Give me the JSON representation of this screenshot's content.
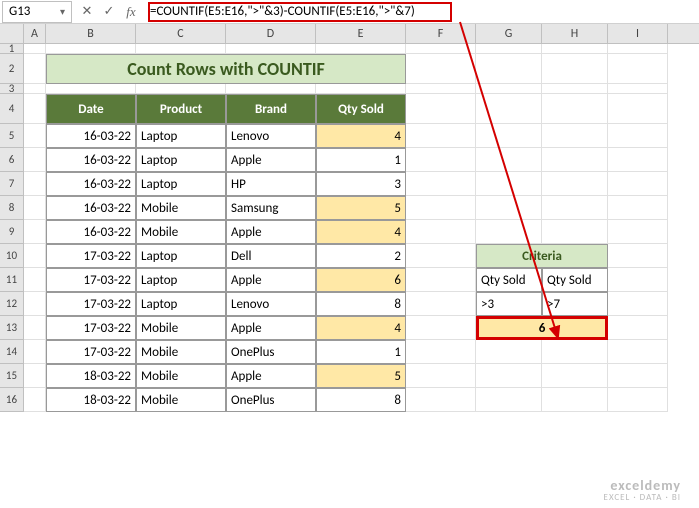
{
  "nameBox": "G13",
  "formula": "=COUNTIF(E5:E16,\">\"&3)-COUNTIF(E5:E16,\">\"&7)",
  "columns": [
    "A",
    "B",
    "C",
    "D",
    "E",
    "F",
    "G",
    "H",
    "I"
  ],
  "rowNums": [
    "1",
    "2",
    "3",
    "4",
    "5",
    "6",
    "7",
    "8",
    "9",
    "10",
    "11",
    "12",
    "13",
    "14",
    "15",
    "16"
  ],
  "title": "Count Rows with COUNTIF",
  "headers": {
    "b": "Date",
    "c": "Product",
    "d": "Brand",
    "e": "Qty Sold"
  },
  "rows": [
    {
      "date": "16-03-22",
      "product": "Laptop",
      "brand": "Lenovo",
      "qty": "4",
      "hl": true
    },
    {
      "date": "16-03-22",
      "product": "Laptop",
      "brand": "Apple",
      "qty": "1",
      "hl": false
    },
    {
      "date": "16-03-22",
      "product": "Laptop",
      "brand": "HP",
      "qty": "3",
      "hl": false
    },
    {
      "date": "16-03-22",
      "product": "Mobile",
      "brand": "Samsung",
      "qty": "5",
      "hl": true
    },
    {
      "date": "16-03-22",
      "product": "Mobile",
      "brand": "Apple",
      "qty": "4",
      "hl": true
    },
    {
      "date": "17-03-22",
      "product": "Laptop",
      "brand": "Dell",
      "qty": "2",
      "hl": false
    },
    {
      "date": "17-03-22",
      "product": "Laptop",
      "brand": "Apple",
      "qty": "6",
      "hl": true
    },
    {
      "date": "17-03-22",
      "product": "Laptop",
      "brand": "Lenovo",
      "qty": "8",
      "hl": false
    },
    {
      "date": "17-03-22",
      "product": "Mobile",
      "brand": "Apple",
      "qty": "4",
      "hl": true
    },
    {
      "date": "17-03-22",
      "product": "Mobile",
      "brand": "OnePlus",
      "qty": "1",
      "hl": false
    },
    {
      "date": "18-03-22",
      "product": "Mobile",
      "brand": "Apple",
      "qty": "5",
      "hl": true
    },
    {
      "date": "18-03-22",
      "product": "Mobile",
      "brand": "OnePlus",
      "qty": "8",
      "hl": false
    }
  ],
  "criteria": {
    "header": "Criteria",
    "col1_label": "Qty Sold",
    "col2_label": "Qty Sold",
    "col1_val": ">3",
    "col2_val": ">7",
    "result": "6"
  },
  "watermark": {
    "line1": "exceldemy",
    "line2": "EXCEL · DATA · BI"
  }
}
